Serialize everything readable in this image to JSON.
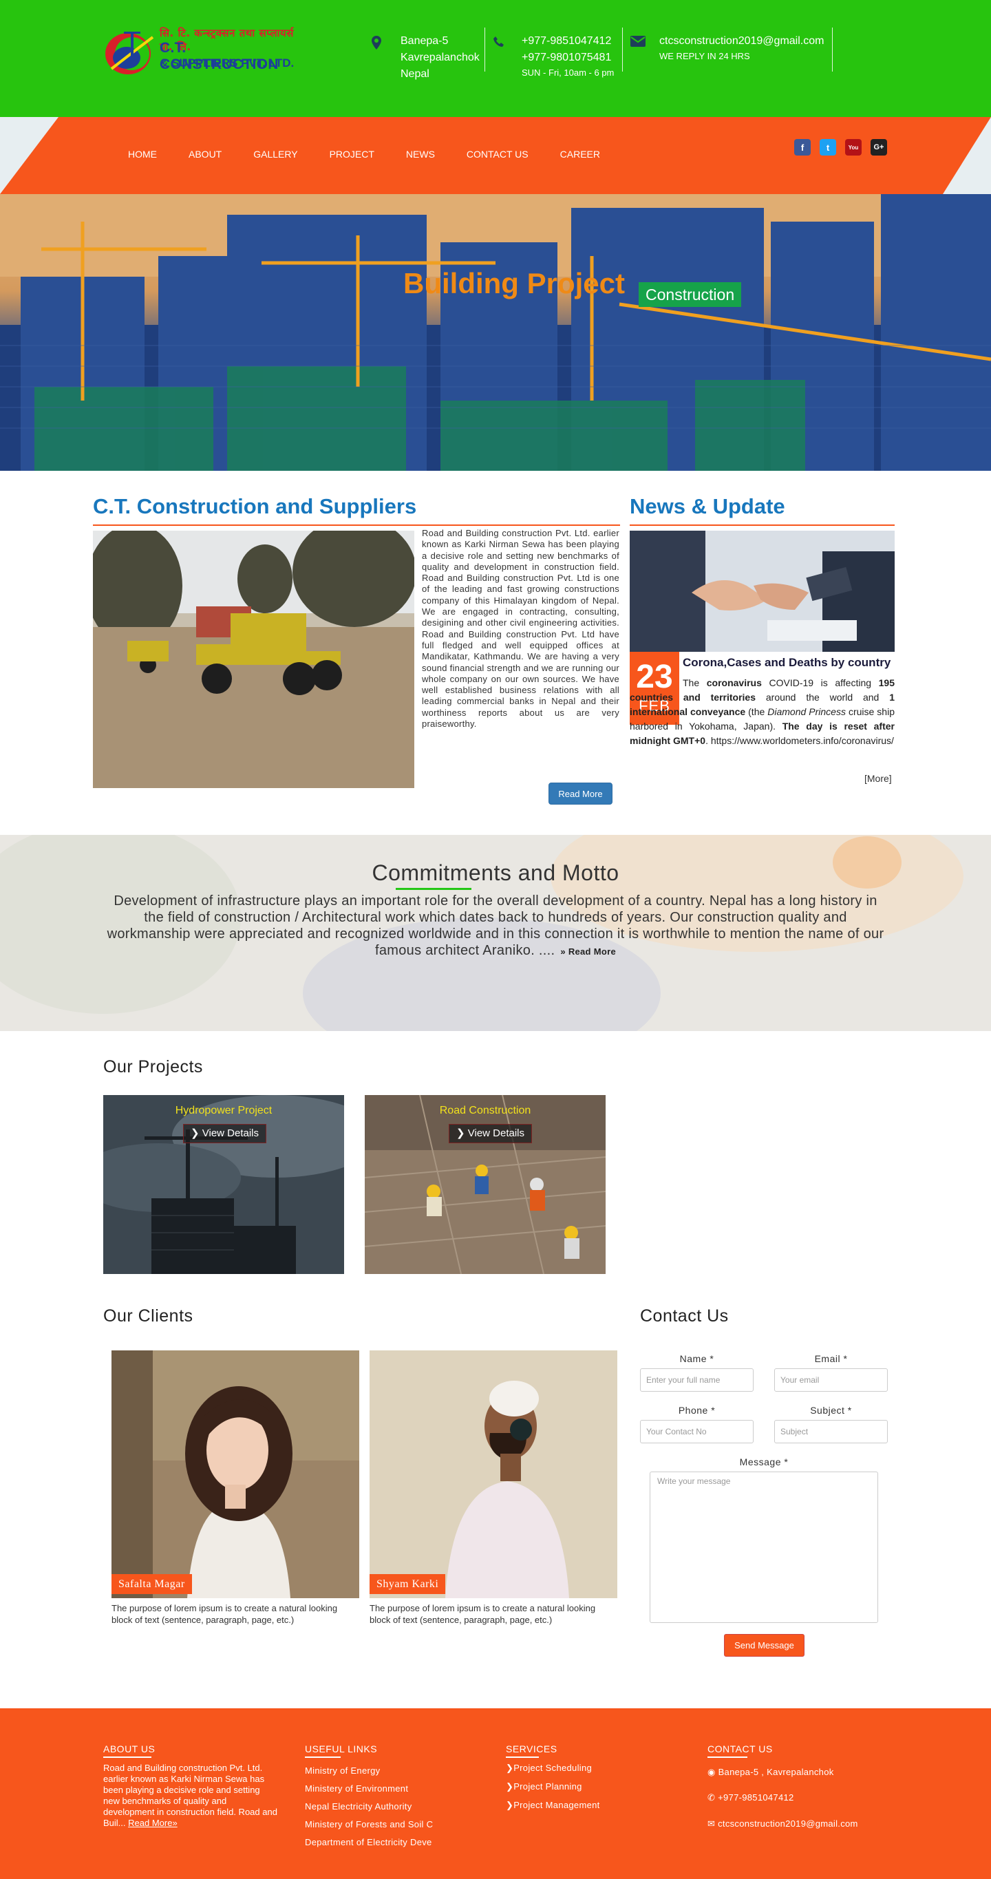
{
  "header": {
    "logo": {
      "line1": "सि. टि. कन्स्ट्रक्सन तथा सप्लायर्स प्रा. लि.",
      "line2": "C.T. CONSTRUCTION",
      "line3": "& SUPPLIERS PVT. LTD."
    },
    "address": {
      "line1": "Banepa-5",
      "line2": "Kavrepalanchok",
      "line3": "Nepal",
      "icon": "map-marker-icon"
    },
    "phone": {
      "line1": "+977-9851047412",
      "line2": "+977-9801075481",
      "hours": "SUN - Fri, 10am - 6 pm",
      "icon": "phone-icon"
    },
    "email": {
      "address": "ctcsconstruction2019@gmail.com",
      "note": "WE REPLY IN 24 HRS",
      "icon": "envelope-icon"
    },
    "colors": {
      "green": "#27c40e",
      "orange": "#f7561c"
    }
  },
  "nav": {
    "items": [
      "HOME",
      "ABOUT",
      "GALLERY",
      "PROJECT",
      "NEWS",
      "CONTACT US",
      "CAREER"
    ],
    "social": [
      {
        "label": "f",
        "icon": "facebook-icon",
        "color": "#3b5998"
      },
      {
        "label": "t",
        "icon": "twitter-icon",
        "color": "#1da1f2"
      },
      {
        "label": "You",
        "icon": "youtube-icon",
        "color": "#b31217"
      },
      {
        "label": "G+",
        "icon": "google-plus-icon",
        "color": "#222"
      }
    ]
  },
  "hero": {
    "title": "Building Project",
    "badge": "Construction"
  },
  "about": {
    "heading": "C.T. Construction and Suppliers",
    "text": "Road and Building construction Pvt. Ltd. earlier known as Karki Nirman Sewa has been playing a decisive role and setting new benchmarks of quality and development in construction field. Road and Building construction Pvt. Ltd is one of the leading and fast growing constructions company of this Himalayan kingdom of Nepal. We are engaged in contracting, consulting, desigining and other civil engineering activities. Road and Building construction Pvt. Ltd have full fledged and well equipped offices at Mandikatar, Kathmandu. We are having a very sound financial strength and we are running our whole company on our own sources. We have well established business relations with all leading commercial banks in Nepal and their worthiness reports about us are very praiseworthy.",
    "button": "Read More"
  },
  "news": {
    "heading": "News & Update",
    "day": "23",
    "month": "FEB",
    "title": "Corona,Cases and Deaths by country",
    "body": {
      "p1": "The ",
      "b1": "coronavirus",
      "p2": " COVID-19 is affecting ",
      "b2": "195 countries and territories",
      "p3": " around the world and ",
      "b3": "1 international conveyance",
      "p4": " (the ",
      "i1": "Diamond Princess",
      "p5": " cruise ship harbored in Yokohama, Japan). ",
      "b4": "The day is reset after midnight GMT+0",
      "p6": ". https://www.worldometers.info/coronavirus/"
    },
    "more": "[More]"
  },
  "motto": {
    "title": "Commitments and Motto",
    "text": "Development of infrastructure plays an important role for the overall development of a country. Nepal has a long history in the field of construction / Architectural work which dates back to hundreds of years. Our construction quality and workmanship were appreciated and recognized worldwide and in this connection it is worthwhile to mention the name of our famous architect Araniko. ....",
    "read_more": "Read More"
  },
  "projects": {
    "heading": "Our Projects",
    "items": [
      {
        "title": "Hydropower Project",
        "button": "View Details"
      },
      {
        "title": "Road Construction",
        "button": "View Details"
      }
    ]
  },
  "clients": {
    "heading": "Our Clients",
    "items": [
      {
        "name": "Safalta Magar",
        "desc": "The purpose of lorem ipsum is to create a natural looking block of text (sentence, paragraph, page, etc.)"
      },
      {
        "name": "Shyam Karki",
        "desc": "The purpose of lorem ipsum is to create a natural looking block of text (sentence, paragraph, page, etc.)"
      }
    ]
  },
  "contact": {
    "heading": "Contact Us",
    "name_label": "Name *",
    "name_placeholder": "Enter your full name",
    "email_label": "Email *",
    "email_placeholder": "Your email",
    "phone_label": "Phone *",
    "phone_placeholder": "Your Contact No",
    "subject_label": "Subject *",
    "subject_placeholder": "Subject",
    "message_label": "Message *",
    "message_placeholder": "Write your message",
    "button": "Send Message"
  },
  "footer": {
    "about_heading": "ABOUT US",
    "about_text": "Road and Building construction Pvt. Ltd. earlier known as Karki Nirman Sewa has been playing a decisive role and setting new benchmarks of quality and development in construction field. Road and Buil...",
    "about_link": "Read More»",
    "links_heading": "USEFUL LINKS",
    "links": [
      "Ministry of Energy",
      "Ministery of Environment",
      "Nepal Electricity Authority",
      "Ministery of Forests and Soil C",
      "Department of Electricity Deve"
    ],
    "services_heading": "SERVICES",
    "services": [
      "Project Scheduling",
      "Project Planning",
      "Project Management"
    ],
    "contact_heading": "CONTACT US",
    "contact_address": "Banepa-5 , Kavrepalanchok",
    "contact_phone": "+977-9851047412",
    "contact_email": "ctcsconstruction2019@gmail.com"
  }
}
